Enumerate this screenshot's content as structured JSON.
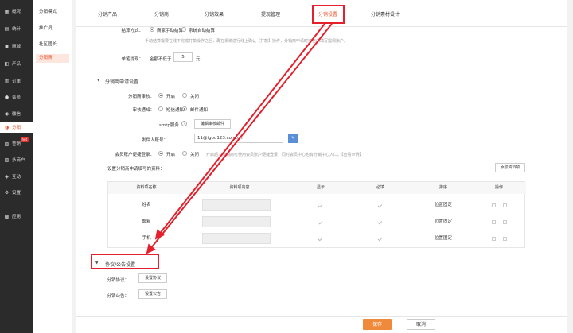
{
  "sidebar": {
    "items": [
      {
        "label": "概况",
        "icon": "dashboard-icon",
        "glyph": "▦"
      },
      {
        "label": "统计",
        "icon": "stats-icon",
        "glyph": "▤"
      },
      {
        "label": "商城",
        "icon": "store-icon",
        "glyph": "▣"
      },
      {
        "label": "产品",
        "icon": "product-icon",
        "glyph": "◧"
      },
      {
        "label": "订单",
        "icon": "order-icon",
        "glyph": "▥"
      },
      {
        "label": "会员",
        "icon": "member-icon",
        "glyph": "●"
      },
      {
        "label": "微信",
        "icon": "wechat-icon",
        "glyph": "◉"
      },
      {
        "label": "分销",
        "icon": "distribution-icon",
        "glyph": "◑"
      },
      {
        "label": "营销",
        "icon": "marketing-icon",
        "glyph": "▧"
      },
      {
        "label": "多商户",
        "icon": "merchant-icon",
        "glyph": "▨"
      },
      {
        "label": "互动",
        "icon": "interact-icon",
        "glyph": "◈"
      },
      {
        "label": "设置",
        "icon": "settings-icon",
        "glyph": "⚙"
      },
      {
        "label": "应用",
        "icon": "apps-icon",
        "glyph": "▩"
      }
    ],
    "hot_badge": "hot"
  },
  "subnav": {
    "items": [
      "分销模式",
      "推广员",
      "社区团长",
      "分销商"
    ]
  },
  "tabs": [
    "分销产品",
    "分销商",
    "分销效果",
    "提现管理",
    "分销设置",
    "分销素材设计"
  ],
  "settle": {
    "label": "结算方式：",
    "opt1": "商家手动结算",
    "opt2": "系统自动结算",
    "hint": "手动结算需要在线下完成打款操作之后，再在系统进行线上确认【打款】操作，分销商申请时可自由填写提现账户。"
  },
  "min_withdraw": {
    "label": "单笔提现：",
    "prefix": "金额不低于",
    "value": "5",
    "unit": "元"
  },
  "apply_section": {
    "title": "分销商申请设置",
    "audit_label": "分销商审核：",
    "audit_on": "开启",
    "audit_off": "关闭",
    "notify_label": "审核通知：",
    "notify_sms": "短信通知",
    "notify_mail": "邮件通知",
    "smtp_label": "smtp服务",
    "smtp_help": "?",
    "smtp_btn": "编辑审核邮件",
    "sender_label": "发件人账号：",
    "sender_value": "11@igou123.com.cn",
    "sender_btn_icon": "edit-icon",
    "quick_label": "会员账户便捷登录：",
    "quick_on": "开启",
    "quick_off": "关闭",
    "quick_hint": "开启后，分销商可使用会员账户便捷登录，同时会员中心也有分销中心入口。【查看示例】",
    "fields_label": "设置分销商申请填写的资料：",
    "add_btn": "添加资料项"
  },
  "table": {
    "headers": [
      "资料项名称",
      "资料项内容",
      "显示",
      "必填",
      "排序",
      "操作"
    ],
    "rows": [
      {
        "name": "姓名",
        "sort": "位置固定"
      },
      {
        "name": "邮箱",
        "sort": "位置固定"
      },
      {
        "name": "手机",
        "sort": "位置固定"
      }
    ]
  },
  "agreement": {
    "title": "协议/公告设置",
    "protocol_label": "分销协议：",
    "protocol_btn": "设置协议",
    "notice_label": "分销公告：",
    "notice_btn": "设置公告"
  },
  "footer": {
    "save": "保存",
    "cancel": "取消"
  },
  "colors": {
    "accent": "#e8542f",
    "highlight": "#e3202b",
    "save": "#f08a3b"
  }
}
